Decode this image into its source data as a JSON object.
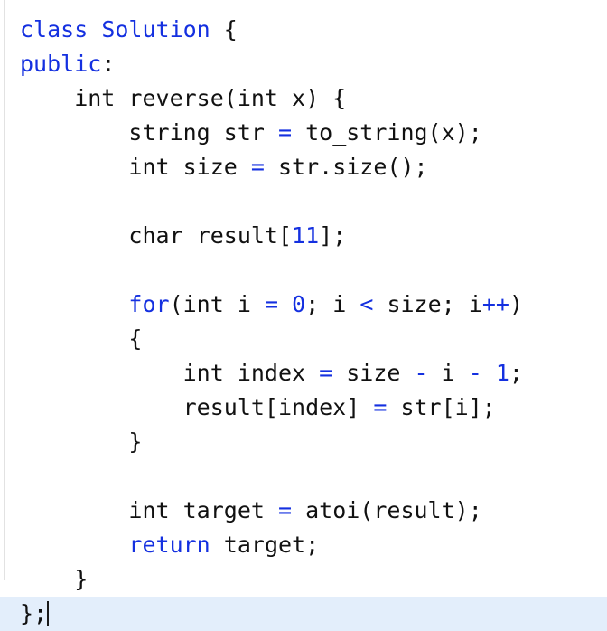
{
  "editor": {
    "language": "cpp",
    "colors": {
      "background": "#ffffff",
      "foreground": "#111111",
      "keyword": "#1430e0",
      "operator": "#1430e0",
      "number": "#1430e0",
      "current_line_highlight": "#e3eefb",
      "gutter_rule": "#e2e2e2",
      "caret": "#1a1a1a"
    },
    "caret_line_index": 17,
    "code_text": "class Solution {\npublic:\n    int reverse(int x) {\n        string str = to_string(x);\n        int size = str.size();\n\n        char result[11];\n\n        for(int i = 0; i < size; i++)\n        {\n            int index = size - i - 1;\n            result[index] = str[i];\n        }\n\n        int target = atoi(result);\n        return target;\n    }\n};",
    "lines": [
      {
        "index": 0,
        "current": false,
        "tokens": [
          {
            "t": "class",
            "k": "kw"
          },
          {
            "t": " ",
            "k": "pl"
          },
          {
            "t": "Solution",
            "k": "kw"
          },
          {
            "t": " {",
            "k": "pl"
          }
        ]
      },
      {
        "index": 1,
        "current": false,
        "tokens": [
          {
            "t": "public",
            "k": "kw"
          },
          {
            "t": ":",
            "k": "pl"
          }
        ]
      },
      {
        "index": 2,
        "current": false,
        "tokens": [
          {
            "t": "    int reverse(int x) {",
            "k": "pl"
          }
        ]
      },
      {
        "index": 3,
        "current": false,
        "tokens": [
          {
            "t": "        string str ",
            "k": "pl"
          },
          {
            "t": "=",
            "k": "op"
          },
          {
            "t": " to_string(x);",
            "k": "pl"
          }
        ]
      },
      {
        "index": 4,
        "current": false,
        "tokens": [
          {
            "t": "        int size ",
            "k": "pl"
          },
          {
            "t": "=",
            "k": "op"
          },
          {
            "t": " str.size();",
            "k": "pl"
          }
        ]
      },
      {
        "index": 5,
        "current": false,
        "tokens": [
          {
            "t": "",
            "k": "pl"
          }
        ]
      },
      {
        "index": 6,
        "current": false,
        "tokens": [
          {
            "t": "        char result[",
            "k": "pl"
          },
          {
            "t": "11",
            "k": "num"
          },
          {
            "t": "];",
            "k": "pl"
          }
        ]
      },
      {
        "index": 7,
        "current": false,
        "tokens": [
          {
            "t": "",
            "k": "pl"
          }
        ]
      },
      {
        "index": 8,
        "current": false,
        "tokens": [
          {
            "t": "        ",
            "k": "pl"
          },
          {
            "t": "for",
            "k": "kw"
          },
          {
            "t": "(int i ",
            "k": "pl"
          },
          {
            "t": "=",
            "k": "op"
          },
          {
            "t": " ",
            "k": "pl"
          },
          {
            "t": "0",
            "k": "num"
          },
          {
            "t": "; i ",
            "k": "pl"
          },
          {
            "t": "<",
            "k": "op"
          },
          {
            "t": " size; i",
            "k": "pl"
          },
          {
            "t": "++",
            "k": "op"
          },
          {
            "t": ")",
            "k": "pl"
          }
        ]
      },
      {
        "index": 9,
        "current": false,
        "tokens": [
          {
            "t": "        {",
            "k": "pl"
          }
        ]
      },
      {
        "index": 10,
        "current": false,
        "tokens": [
          {
            "t": "            int index ",
            "k": "pl"
          },
          {
            "t": "=",
            "k": "op"
          },
          {
            "t": " size ",
            "k": "pl"
          },
          {
            "t": "-",
            "k": "op"
          },
          {
            "t": " i ",
            "k": "pl"
          },
          {
            "t": "-",
            "k": "op"
          },
          {
            "t": " ",
            "k": "pl"
          },
          {
            "t": "1",
            "k": "num"
          },
          {
            "t": ";",
            "k": "pl"
          }
        ]
      },
      {
        "index": 11,
        "current": false,
        "tokens": [
          {
            "t": "            result[index] ",
            "k": "pl"
          },
          {
            "t": "=",
            "k": "op"
          },
          {
            "t": " str[i];",
            "k": "pl"
          }
        ]
      },
      {
        "index": 12,
        "current": false,
        "tokens": [
          {
            "t": "        }",
            "k": "pl"
          }
        ]
      },
      {
        "index": 13,
        "current": false,
        "tokens": [
          {
            "t": "",
            "k": "pl"
          }
        ]
      },
      {
        "index": 14,
        "current": false,
        "tokens": [
          {
            "t": "        int target ",
            "k": "pl"
          },
          {
            "t": "=",
            "k": "op"
          },
          {
            "t": " atoi(result);",
            "k": "pl"
          }
        ]
      },
      {
        "index": 15,
        "current": false,
        "tokens": [
          {
            "t": "        ",
            "k": "pl"
          },
          {
            "t": "return",
            "k": "kw"
          },
          {
            "t": " target;",
            "k": "pl"
          }
        ]
      },
      {
        "index": 16,
        "current": false,
        "tokens": [
          {
            "t": "    }",
            "k": "pl"
          }
        ]
      },
      {
        "index": 17,
        "current": true,
        "tokens": [
          {
            "t": "};",
            "k": "pl"
          }
        ]
      }
    ]
  }
}
